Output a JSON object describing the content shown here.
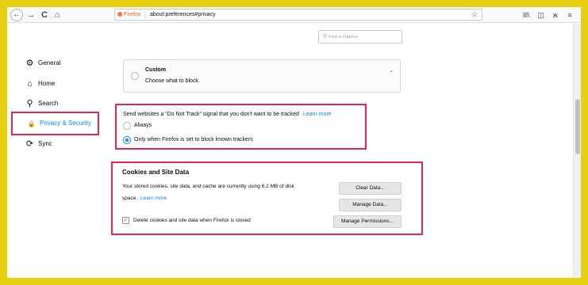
{
  "toolbar": {
    "back_icon": "back-arrow-icon",
    "forward_glyph": "→",
    "reload_glyph": "C",
    "home_glyph": "⌂",
    "identity_label": "Firefox",
    "url": "about:preferences#privacy",
    "bookmark_glyph": "☆",
    "library_glyph": "lll\\",
    "sidebar_glyph": "◫",
    "extension_glyph": "ж",
    "menu_glyph": "≡"
  },
  "search": {
    "placeholder": "Find in Options"
  },
  "sidebar": {
    "items": [
      {
        "label": "General",
        "icon": "gear-icon",
        "glyph": "⚙"
      },
      {
        "label": "Home",
        "icon": "home-icon",
        "glyph": "⌂"
      },
      {
        "label": "Search",
        "icon": "search-icon",
        "glyph": "⚲"
      },
      {
        "label": "Privacy & Security",
        "icon": "lock-icon",
        "glyph": "🔒",
        "active": true
      },
      {
        "label": "Sync",
        "icon": "sync-icon",
        "glyph": "⟳"
      }
    ]
  },
  "custom": {
    "title": "Custom",
    "description": "Choose what to block.",
    "chevron": "⌄"
  },
  "dnt": {
    "prompt": "Send websites a “Do Not Track” signal that you don't want to be tracked",
    "learn_more": "Learn more",
    "options": [
      {
        "label": "Always",
        "selected": false
      },
      {
        "label": "Only when Firefox is set to block known trackers",
        "selected": true
      }
    ]
  },
  "cookies": {
    "heading": "Cookies and Site Data",
    "line1": "Your stored cookies, site data, and cache are currently using 6.2 MB of disk",
    "line2": "space.",
    "learn_more": "Learn more",
    "clear_button": "Clear Data...",
    "manage_button": "Manage Data...",
    "permissions_button": "Manage Permissions...",
    "delete_on_close_label": "Delete cookies and site data when Firefox is closed",
    "delete_on_close_checked": true,
    "check_glyph": "✓"
  },
  "colors": {
    "highlight_border": "#e22850",
    "accent": "#0a84ff",
    "outer_frame": "#e7cf12"
  }
}
